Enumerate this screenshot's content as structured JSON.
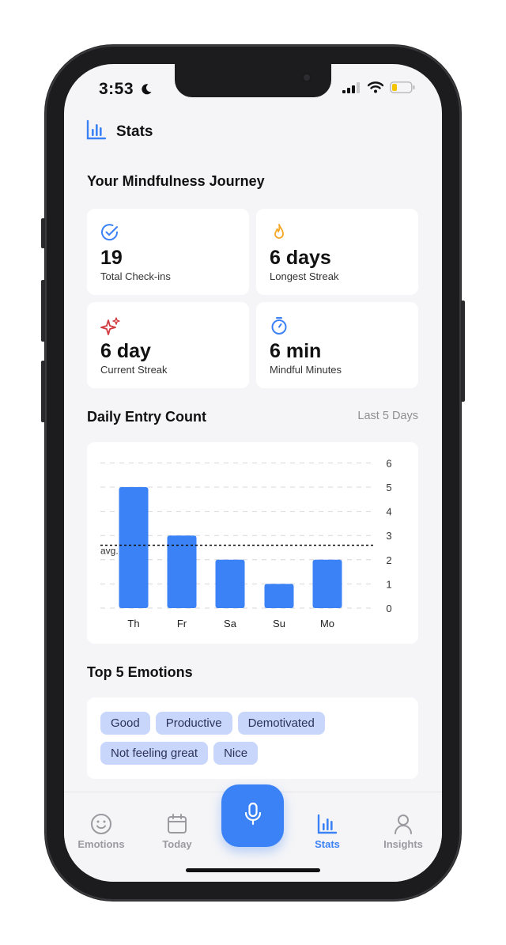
{
  "status_bar": {
    "time": "3:53"
  },
  "header": {
    "title": "Stats"
  },
  "journey": {
    "title": "Your Mindfulness Journey",
    "stats": [
      {
        "value": "19",
        "label": "Total Check-ins",
        "icon": "check-circle-icon",
        "color": "#3b82f6"
      },
      {
        "value": "6 days",
        "label": "Longest Streak",
        "icon": "flame-icon",
        "color": "#f5a623"
      },
      {
        "value": "6 day",
        "label": "Current Streak",
        "icon": "sparkles-icon",
        "color": "#d0393e"
      },
      {
        "value": "6 min",
        "label": "Mindful Minutes",
        "icon": "stopwatch-icon",
        "color": "#3b82f6"
      }
    ]
  },
  "daily": {
    "title": "Daily Entry Count",
    "range": "Last 5 Days",
    "avg_label": "avg."
  },
  "chart_data": {
    "type": "bar",
    "categories": [
      "Th",
      "Fr",
      "Sa",
      "Su",
      "Mo"
    ],
    "values": [
      5,
      3,
      2,
      1,
      2
    ],
    "average": 2.6,
    "ylim": [
      0,
      6
    ],
    "yticks": [
      "0",
      "1",
      "2",
      "3",
      "4",
      "5",
      "6"
    ],
    "grid": true,
    "color": "#3b82f6"
  },
  "emotions": {
    "title": "Top 5 Emotions",
    "items": [
      "Good",
      "Productive",
      "Demotivated",
      "Not feeling great",
      "Nice"
    ]
  },
  "tabs": [
    {
      "label": "Emotions",
      "icon": "smiley-icon",
      "active": false
    },
    {
      "label": "Today",
      "icon": "calendar-icon",
      "active": false
    },
    {
      "label": "Stats",
      "icon": "bar-chart-icon",
      "active": true
    },
    {
      "label": "Insights",
      "icon": "person-icon",
      "active": false
    }
  ],
  "colors": {
    "accent": "#3b82f6",
    "chip_bg": "#c9d6fb",
    "background": "#f5f5f7"
  }
}
